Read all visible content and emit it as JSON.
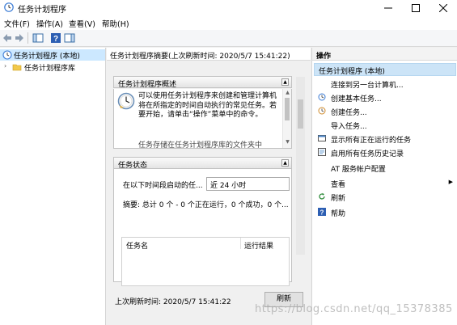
{
  "window": {
    "title": "任务计划程序"
  },
  "window_controls": {
    "minimize": "—",
    "maximize": "□",
    "close": "✕"
  },
  "menu": {
    "file": "文件(F)",
    "action": "操作(A)",
    "view": "查看(V)",
    "help": "帮助(H)"
  },
  "tree": {
    "root": "任务计划程序 (本地)",
    "library": "任务计划程序库"
  },
  "center": {
    "header": "任务计划程序摘要(上次刷新时间: 2020/5/7 15:41:22)",
    "overview": {
      "title": "任务计划程序概述",
      "text": "可以使用任务计划程序来创建和管理计算机将在所指定的时间自动执行的常见任务。若要开始，请单击“操作”菜单中的命令。",
      "truncated": "任务存储在任务计划程序库的文件夹中"
    },
    "status": {
      "title": "任务状态",
      "period_label": "在以下时间段启动的任...",
      "period_value": "近 24 小时",
      "summary": "摘要: 总计 0 个 - 0 个正在运行，0 个成功，0 个...",
      "col_name": "任务名",
      "col_result": "运行结果"
    },
    "last_refresh": "上次刷新时间: 2020/5/7 15:41:22",
    "refresh_button": "刷新"
  },
  "actions": {
    "header": "操作",
    "group": "任务计划程序 (本地)",
    "items": [
      {
        "label": "连接到另一台计算机...",
        "icon": "none"
      },
      {
        "label": "创建基本任务...",
        "icon": "basic-task-icon"
      },
      {
        "label": "创建任务...",
        "icon": "create-task-icon"
      },
      {
        "label": "导入任务...",
        "icon": "none"
      },
      {
        "label": "显示所有正在运行的任务",
        "icon": "running-tasks-icon"
      },
      {
        "label": "启用所有任务历史记录",
        "icon": "history-icon"
      },
      {
        "label": "AT 服务帐户配置",
        "icon": "none"
      },
      {
        "label": "查看",
        "icon": "none"
      },
      {
        "label": "刷新",
        "icon": "refresh-icon"
      },
      {
        "label": "帮助",
        "icon": "help-icon"
      }
    ]
  },
  "watermark": "https://blog.csdn.net/qq_15378385",
  "colors": {
    "selection": "#cce8ff",
    "action_group": "#cce4f7",
    "accent": "#0078d7"
  }
}
